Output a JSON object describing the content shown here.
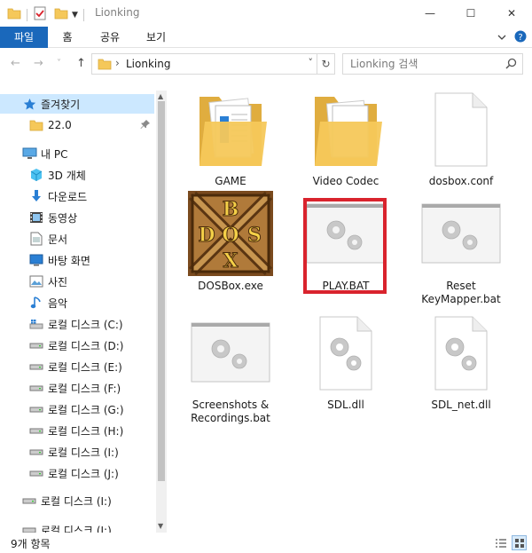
{
  "window": {
    "title": "Lionking",
    "minimize": "—",
    "maximize": "☐",
    "close": "✕"
  },
  "ribbon": {
    "tabs": [
      {
        "label": "파일",
        "active": true
      },
      {
        "label": "홈"
      },
      {
        "label": "공유"
      },
      {
        "label": "보기"
      }
    ],
    "expand_icon": "chevron-down-icon",
    "help_icon": "help-icon"
  },
  "address": {
    "back": "←",
    "forward": "→",
    "recent": "˅",
    "up": "↑",
    "separator": "›",
    "path": "Lionking",
    "dropdown": "˅",
    "refresh": "↻"
  },
  "search": {
    "placeholder": "Lionking 검색"
  },
  "nav": {
    "quick_access": "즐겨찾기",
    "quick_items": [
      {
        "label": "22.0",
        "pinned": true
      }
    ],
    "this_pc": "내 PC",
    "pc_items": [
      {
        "label": "3D 개체",
        "icon": "3d-objects-icon"
      },
      {
        "label": "다운로드",
        "icon": "download-icon"
      },
      {
        "label": "동영상",
        "icon": "video-icon"
      },
      {
        "label": "문서",
        "icon": "document-icon"
      },
      {
        "label": "바탕 화면",
        "icon": "desktop-icon"
      },
      {
        "label": "사진",
        "icon": "picture-icon"
      },
      {
        "label": "음악",
        "icon": "music-icon"
      },
      {
        "label": "로컬 디스크 (C:)",
        "icon": "windows-drive-icon"
      },
      {
        "label": "로컬 디스크 (D:)",
        "icon": "drive-icon"
      },
      {
        "label": "로컬 디스크 (E:)",
        "icon": "drive-icon"
      },
      {
        "label": "로컬 디스크 (F:)",
        "icon": "drive-icon"
      },
      {
        "label": "로컬 디스크 (G:)",
        "icon": "drive-icon"
      },
      {
        "label": "로컬 디스크 (H:)",
        "icon": "drive-icon"
      },
      {
        "label": "로컬 디스크 (I:)",
        "icon": "drive-icon"
      },
      {
        "label": "로컬 디스크 (J:)",
        "icon": "drive-icon"
      }
    ],
    "extra_items": [
      {
        "label": "로컬 디스크 (I:)",
        "icon": "drive-icon"
      },
      {
        "label": "로컬 디스크 (I:)",
        "icon": "drive-icon"
      }
    ]
  },
  "files": [
    {
      "name": "GAME",
      "type": "folder-docs"
    },
    {
      "name": "Video Codec",
      "type": "folder-empty"
    },
    {
      "name": "dosbox.conf",
      "type": "blank"
    },
    {
      "name": "DOSBox.exe",
      "type": "dosbox",
      "logo_letters": [
        "B",
        "D",
        "O",
        "S",
        "X"
      ]
    },
    {
      "name": "PLAY.BAT",
      "type": "batch",
      "highlighted": true
    },
    {
      "name": "Reset KeyMapper.bat",
      "type": "batch"
    },
    {
      "name": "Screenshots & Recordings.bat",
      "type": "batch"
    },
    {
      "name": "SDL.dll",
      "type": "dll"
    },
    {
      "name": "SDL_net.dll",
      "type": "dll"
    }
  ],
  "status": {
    "count": "9개 항목"
  },
  "colors": {
    "accent": "#1a68bb",
    "selection": "#cce8ff",
    "highlight": "#d9232d",
    "folder": "#f5c85a"
  }
}
